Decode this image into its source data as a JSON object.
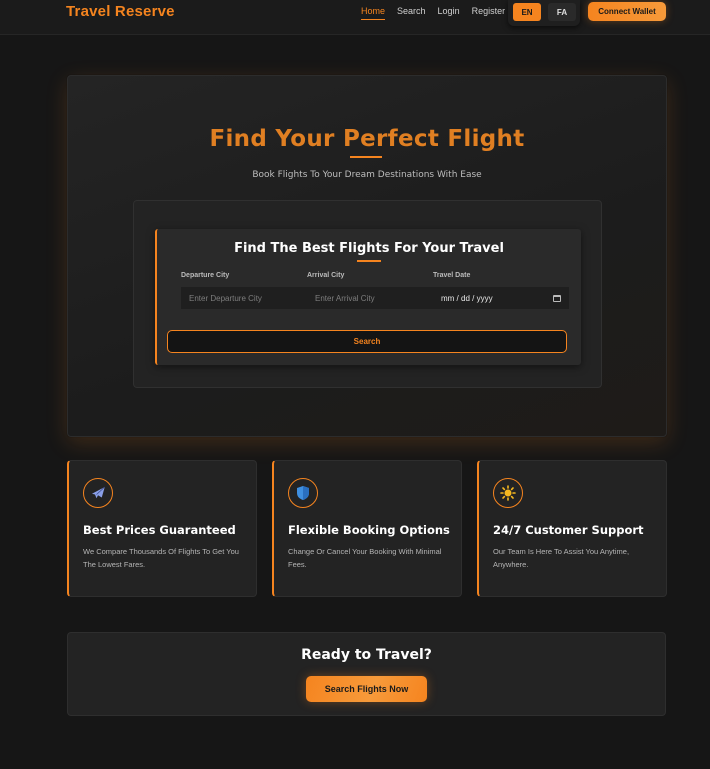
{
  "header": {
    "brand": "Travel Reserve",
    "nav": [
      "Home",
      "Search",
      "Login",
      "Register"
    ],
    "active_nav": "Home",
    "lang_en": "EN",
    "lang_fa": "FA",
    "wallet_label": "Connect Wallet"
  },
  "hero": {
    "title": "Find Your Perfect Flight",
    "subtitle": "Book Flights To Your Dream Destinations With Ease"
  },
  "search": {
    "title": "Find The Best Flights For Your Travel",
    "departure_label": "Departure City",
    "departure_placeholder": "Enter Departure City",
    "arrival_label": "Arrival City",
    "arrival_placeholder": "Enter Arrival City",
    "date_label": "Travel Date",
    "date_value": "mm / dd / yyyy",
    "button_label": "Search"
  },
  "features": [
    {
      "icon": "airplane-icon",
      "title": "Best Prices Guaranteed",
      "desc": "We Compare Thousands Of Flights To Get You The Lowest Fares."
    },
    {
      "icon": "shield-icon",
      "title": "Flexible Booking Options",
      "desc": "Change Or Cancel Your Booking With Minimal Fees."
    },
    {
      "icon": "sun-icon",
      "title": "24/7 Customer Support",
      "desc": "Our Team Is Here To Assist You Anytime, Anywhere."
    }
  ],
  "cta": {
    "title": "Ready to Travel?",
    "button_label": "Search Flights Now"
  },
  "colors": {
    "accent": "#f5841f",
    "background": "#161616",
    "card": "#232323"
  }
}
